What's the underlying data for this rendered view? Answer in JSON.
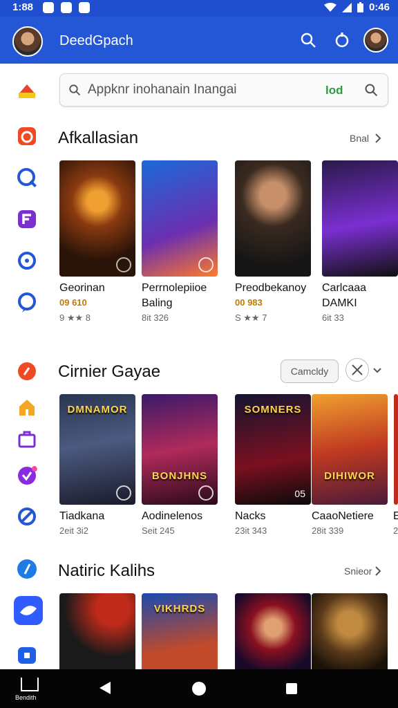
{
  "status_bar": {
    "time": "1:88",
    "clock": "0:46"
  },
  "app_bar": {
    "title": "DeedGpach"
  },
  "search": {
    "query": "Appknr inohanain Inangai",
    "label": "lod"
  },
  "sections": [
    {
      "title": "Afkallasian",
      "more": "Bnal",
      "items": [
        {
          "name": "Georinan",
          "price": "09 610",
          "meta": "9 ★★ 8"
        },
        {
          "name": "Perrnolepiioe",
          "name2": "Baling",
          "meta": "8it 326"
        },
        {
          "name": "Preodbekanoy",
          "price": "00 983",
          "meta": "S ★★ 7"
        },
        {
          "name": "Carlcaaa",
          "name2": "DAMKI",
          "meta": "6it 33"
        }
      ]
    },
    {
      "title": "Cirnier Gayae",
      "chip": "Camcldy",
      "items": [
        {
          "name": "Tiadkana",
          "meta": "2eit 3i2",
          "cover": "DMNAMOR"
        },
        {
          "name": "Aodinelenos",
          "meta": "Seit 245",
          "cover": "BONJHNS"
        },
        {
          "name": "Nacks",
          "meta": "23it 343",
          "cover": "SOMNERS",
          "corner": "05"
        },
        {
          "name": "CaaoNetiere",
          "meta": "28it 339",
          "cover": "DIHIWOR"
        },
        {
          "name": "E",
          "meta": "2"
        }
      ]
    },
    {
      "title": "Natiric Kalihs",
      "more": "Snieor",
      "items": [
        {
          "name": ""
        },
        {
          "name": "",
          "cover": "VIKHRDS"
        },
        {
          "name": ""
        },
        {
          "name": ""
        }
      ]
    }
  ],
  "nav": {
    "home_label": "Bendith"
  }
}
